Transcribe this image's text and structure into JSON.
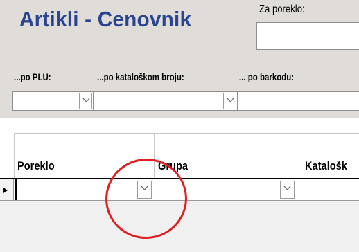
{
  "form": {
    "title": "Artikli - Cenovnik"
  },
  "filters": {
    "origin_label": "Za poreklo:",
    "origin_value": "",
    "plu_label": "...po PLU:",
    "plu_value": "",
    "catalog_label": "...po kataloškom broju:",
    "catalog_value": "",
    "barcode_label": "... po barkodu:",
    "barcode_value": ""
  },
  "grid": {
    "columns": [
      {
        "label": "Poreklo"
      },
      {
        "label": "Grupa"
      },
      {
        "label": "Katalošk"
      }
    ],
    "rows": [
      {
        "poreklo": "",
        "grupa": "",
        "katalog": ""
      }
    ]
  },
  "icons": {
    "dropdown": "chevron-down-icon",
    "row_pointer": "record-pointer-icon"
  },
  "colors": {
    "title": "#2a4590",
    "panel_background": "#e0ddd8",
    "annotation_circle": "#e02020"
  }
}
